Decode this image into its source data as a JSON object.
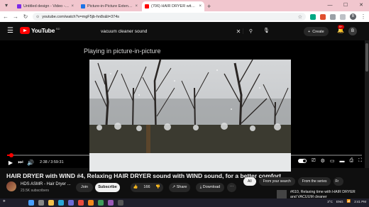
{
  "browser": {
    "tabs": [
      {
        "label": "Untitled design - Video - Canva",
        "active": false,
        "favicon_color": "#7d2ae8"
      },
      {
        "label": "Picture-in-Picture Extension (b...",
        "active": false,
        "favicon_color": "#1a73e8"
      },
      {
        "label": "(706) HAIR DRYER with WIND #...",
        "active": true,
        "favicon_color": "#ff0000"
      }
    ],
    "new_tab_label": "+",
    "url": "youtube.com/watch?v=mgF5jb-hn8s&t=374s"
  },
  "youtube": {
    "logo_text": "YouTube",
    "logo_country": "BD",
    "search_query": "vacuum cleaner sound",
    "create_label": "Create",
    "notification_count": "9+",
    "avatar_initial": "B"
  },
  "player": {
    "pip_message": "Playing in picture-in-picture",
    "current_time": "2:38 / 3:59:31",
    "progress_fraction": 0.011
  },
  "video": {
    "title": "HAIR DRYER with WIND #4, Relaxing HAIR DRYER sound with WIND sound, for a better comfort",
    "channel_name": "HDS ASMR - Hair Dryer ...",
    "subscribers": "23.5K subscribers",
    "join_label": "Join",
    "subscribe_label": "Subscribe",
    "likes": "166",
    "share_label": "Share",
    "download_label": "Download"
  },
  "chips": [
    {
      "label": "All",
      "active": true
    },
    {
      "label": "From your search",
      "active": false
    },
    {
      "label": "From the series",
      "active": false
    },
    {
      "label": "Fr",
      "active": false
    }
  ],
  "suggestion": {
    "title": "#610, Relaxing time with HAIR DRYER and VACUUM cleaner"
  },
  "taskbar": {
    "weather": "3°C",
    "language": "ENG",
    "time": "2:41 PM"
  }
}
